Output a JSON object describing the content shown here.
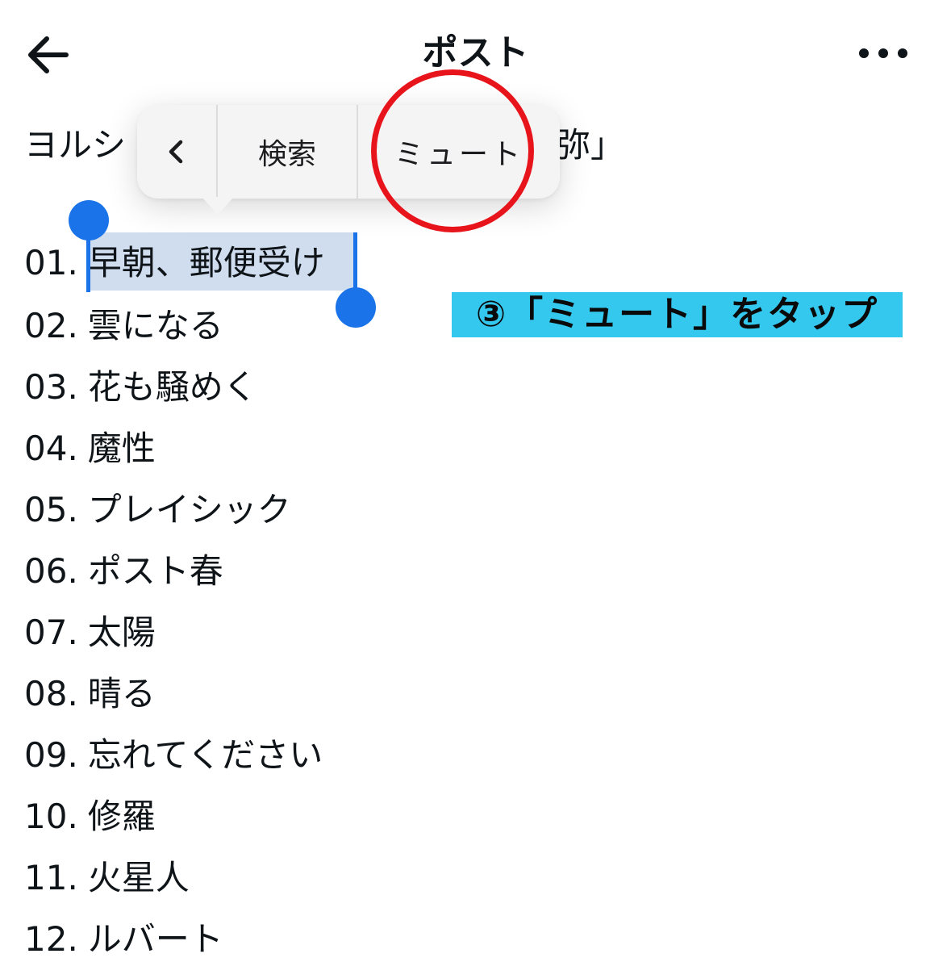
{
  "header": {
    "title": "ポスト",
    "back_icon": "arrow-left-icon",
    "more_icon": "more-horizontal-icon"
  },
  "post": {
    "intro_visible_start": "ヨルシ",
    "intro_visible_end": "弥」"
  },
  "tracks": [
    {
      "num": "01.",
      "title": "早朝、郵便受け"
    },
    {
      "num": "02.",
      "title": "雲になる"
    },
    {
      "num": "03.",
      "title": "花も騒めく"
    },
    {
      "num": "04.",
      "title": "魔性"
    },
    {
      "num": "05.",
      "title": "プレイシック"
    },
    {
      "num": "06.",
      "title": "ポスト春"
    },
    {
      "num": "07.",
      "title": "太陽"
    },
    {
      "num": "08.",
      "title": "晴る"
    },
    {
      "num": "09.",
      "title": "忘れてください"
    },
    {
      "num": "10.",
      "title": "修羅"
    },
    {
      "num": "11.",
      "title": "火星人"
    },
    {
      "num": "12.",
      "title": "ルバート"
    }
  ],
  "context_menu": {
    "prev_label": "‹",
    "search_label": "検索",
    "mute_label": "ミュート"
  },
  "annotation": {
    "step_text": "③「ミュート」をタップ"
  },
  "colors": {
    "selection": "#1a73e8",
    "highlight": "#cfddee",
    "annotation_circle": "#e8141b",
    "annotation_bg": "#34c8ee"
  }
}
